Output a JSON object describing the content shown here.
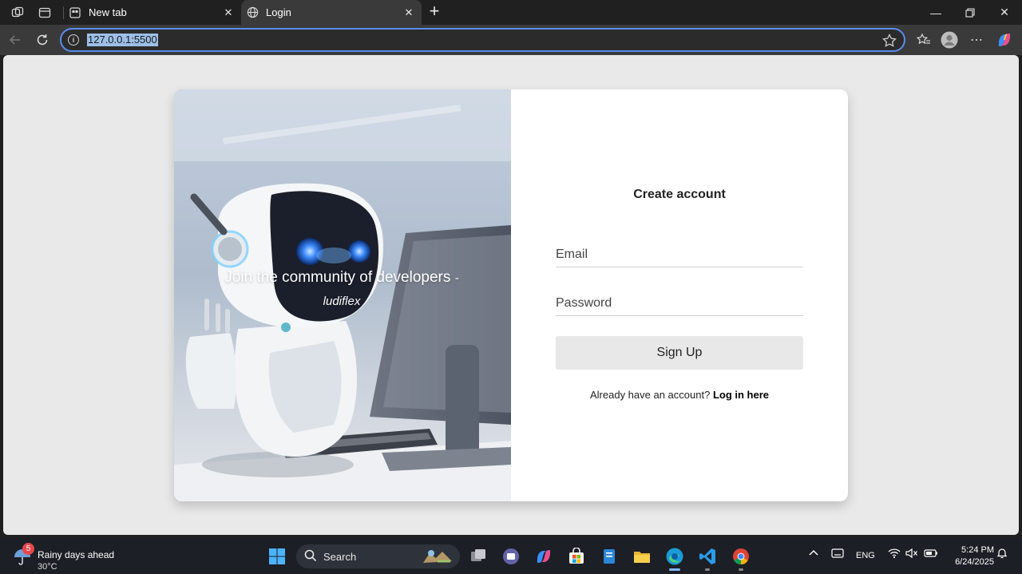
{
  "browser": {
    "tabs": [
      {
        "title": "New tab",
        "active": false
      },
      {
        "title": "Login",
        "active": true
      }
    ],
    "address": "127.0.0.1:5500"
  },
  "page": {
    "hero_quote": "Join the community of developers",
    "hero_author": "- ludiflex",
    "form_title": "Create account",
    "email_placeholder": "Email",
    "password_placeholder": "Password",
    "signup_label": "Sign Up",
    "login_prompt": "Already have an account?",
    "login_link": "Log in here"
  },
  "taskbar": {
    "weather_title": "Rainy days ahead",
    "weather_temp": "30°C",
    "weather_badge": "5",
    "search_placeholder": "Search",
    "language": "ENG",
    "time": "5:24 PM",
    "date": "6/24/2025"
  },
  "colors": {
    "address_focus": "#5b8def",
    "page_bg": "#e9e9e9",
    "signup_bg": "#e8e8e8"
  }
}
